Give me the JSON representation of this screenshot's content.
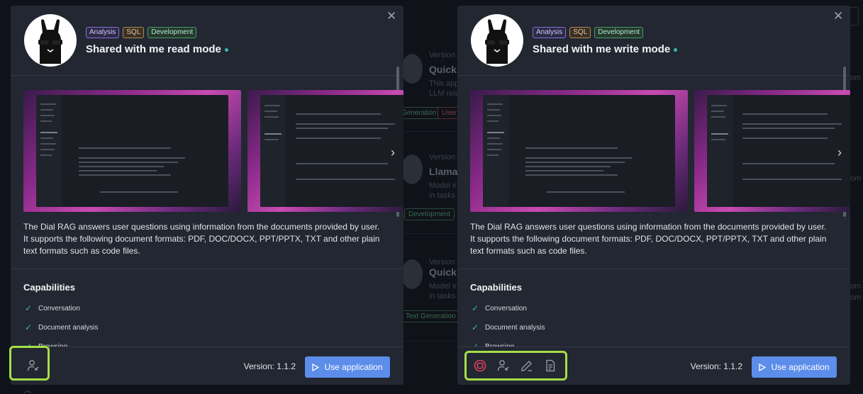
{
  "left_modal": {
    "tags": [
      "Analysis",
      "SQL",
      "Development"
    ],
    "title": "Shared with me read mode",
    "description": "The Dial RAG answers user questions using information from the documents provided by user. It supports the following document formats: PDF, DOC/DOCX, PPT/PPTX, TXT and other plain text formats such as code files.",
    "capabilities_title": "Capabilities",
    "capabilities": [
      "Conversation",
      "Document analysis",
      "Browsing"
    ],
    "version_label": "Version: 1.1.2",
    "use_button": "Use application",
    "footer_icons": [
      "share-user-icon"
    ]
  },
  "right_modal": {
    "tags": [
      "Analysis",
      "SQL",
      "Development"
    ],
    "title": "Shared with me write mode",
    "description": "The Dial RAG answers user questions using information from the documents provided by user. It supports the following document formats: PDF, DOC/DOCX, PPT/PPTX, TXT and other plain text formats such as code files.",
    "capabilities_title": "Capabilities",
    "capabilities": [
      "Conversation",
      "Document analysis",
      "Browsing"
    ],
    "version_label": "Version: 1.1.2",
    "use_button": "Use application",
    "footer_icons": [
      "stop-icon",
      "share-user-icon",
      "edit-icon",
      "file-icon"
    ]
  },
  "background": {
    "cards": [
      {
        "version": "Version:",
        "title": "Quick",
        "desc1": "This app",
        "desc2": "LLM rela"
      },
      {
        "version": "Version:",
        "title": "Llama",
        "desc1": "Model int",
        "desc2": "in tasks li"
      },
      {
        "version": "Version:",
        "title": "Quick",
        "desc1": "Model int",
        "desc2": "in tasks li"
      }
    ],
    "tags": [
      "Generation",
      "User",
      "Development",
      "Text Generation"
    ],
    "right_edge": [
      "om",
      "om",
      "om",
      "om"
    ]
  },
  "colors": {
    "accent": "#5c8dea",
    "highlight": "#a6de46",
    "check": "#37bab0",
    "stop_icon": "#e0435e"
  }
}
